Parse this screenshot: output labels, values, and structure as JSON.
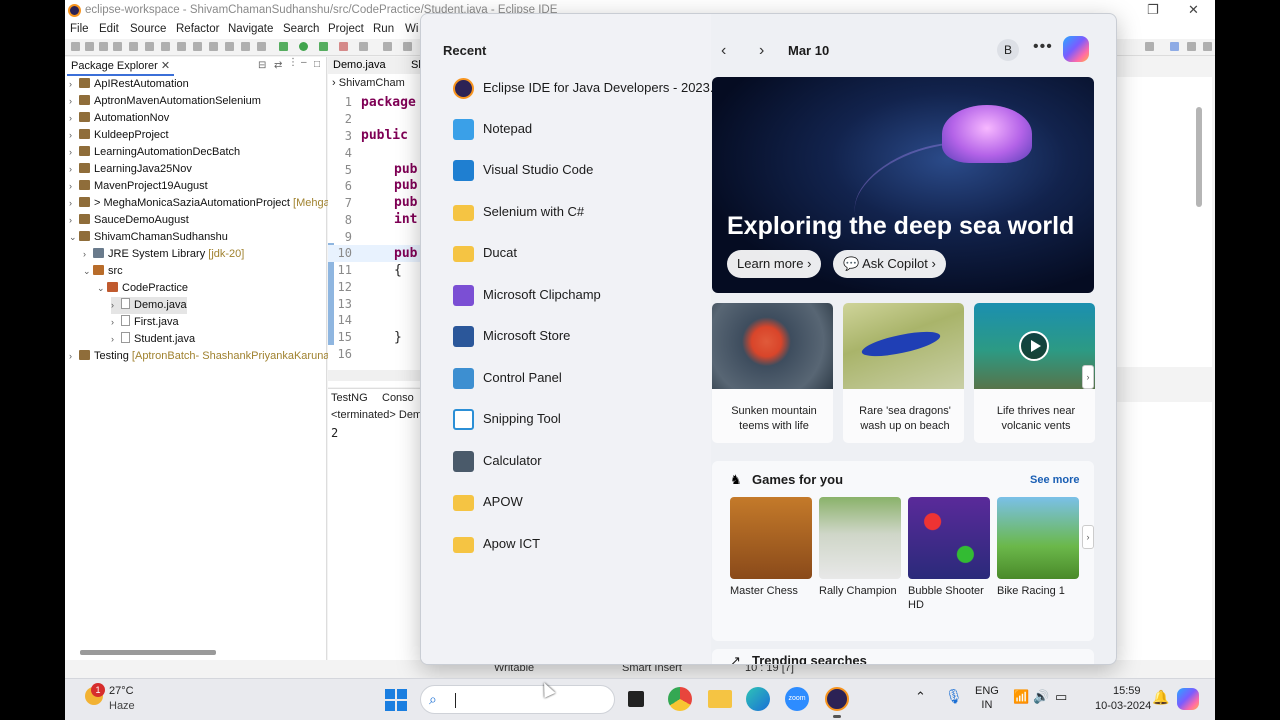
{
  "eclipse": {
    "window_title": "eclipse-workspace - ShivamChamanSudhanshu/src/CodePractice/Student.java - Eclipse IDE",
    "menu": [
      "File",
      "Edit",
      "Source",
      "Refactor",
      "Navigate",
      "Search",
      "Project",
      "Run",
      "Wi"
    ],
    "package_explorer": {
      "tab_label": "Package Explorer",
      "tab_close": "✕",
      "items": [
        {
          "label": "ApIRestAutomation",
          "suffix": ""
        },
        {
          "label": "AptronMavenAutomationSelenium",
          "suffix": ""
        },
        {
          "label": "AutomationNov",
          "suffix": ""
        },
        {
          "label": "KuldeepProject",
          "suffix": ""
        },
        {
          "label": "LearningAutomationDecBatch",
          "suffix": ""
        },
        {
          "label": "LearningJava25Nov",
          "suffix": ""
        },
        {
          "label": "MavenProject19August",
          "suffix": ""
        },
        {
          "label": "> MeghaMonicaSaziaAutomationProject",
          "suffix": "[Mehgal"
        },
        {
          "label": "SauceDemoAugust",
          "suffix": ""
        },
        {
          "label": "ShivamChamanSudhanshu",
          "suffix": ""
        },
        {
          "label": "JRE System Library",
          "suffix": "[jdk-20]"
        },
        {
          "label": "src",
          "suffix": ""
        },
        {
          "label": "CodePractice",
          "suffix": ""
        },
        {
          "label": "Demo.java",
          "suffix": ""
        },
        {
          "label": "First.java",
          "suffix": ""
        },
        {
          "label": "Student.java",
          "suffix": ""
        },
        {
          "label": "Testing",
          "suffix": "[AptronBatch- ShashankPriyankaKaruna m"
        }
      ]
    },
    "editor": {
      "tab1": "Demo.java",
      "tab2": "ShivamCham",
      "line_numbers": [
        "1",
        "2",
        "3",
        "4",
        "5",
        "6",
        "7",
        "8",
        "9",
        "10",
        "11",
        "12",
        "13",
        "14",
        "15",
        "16"
      ],
      "code": {
        "l1": "package",
        "l3": "public",
        "l5": "pub",
        "l6": "pub",
        "l7": "pub",
        "l8": "int",
        "l10": "pub",
        "l11": "{",
        "l15": "}"
      }
    },
    "console": {
      "tab1": "TestNG",
      "tab2": "Conso",
      "terminated": "<terminated> Dem",
      "output": "2"
    },
    "status": {
      "writable": "Writable",
      "insert": "Smart Insert",
      "position": "10 : 19 [7]"
    }
  },
  "start": {
    "recent_title": "Recent",
    "date": "Mar 10",
    "user_initial": "B",
    "more": "•••",
    "apps": [
      {
        "label": "Eclipse IDE for Java Developers - 2023...",
        "icon": "eclipse-icon",
        "color": "#2c2255"
      },
      {
        "label": "Notepad",
        "icon": "notepad-icon",
        "color": "#3aa0e8"
      },
      {
        "label": "Visual Studio Code",
        "icon": "vscode-icon",
        "color": "#1f7fd1"
      },
      {
        "label": "Selenium with C#",
        "icon": "folder-icon",
        "color": "#f5c443"
      },
      {
        "label": "Ducat",
        "icon": "folder-icon",
        "color": "#f5c443"
      },
      {
        "label": "Microsoft Clipchamp",
        "icon": "clipchamp-icon",
        "color": "#7b4fd4"
      },
      {
        "label": "Microsoft Store",
        "icon": "store-icon",
        "color": "#2b579a"
      },
      {
        "label": "Control Panel",
        "icon": "control-panel-icon",
        "color": "#3d8fd1"
      },
      {
        "label": "Snipping Tool",
        "icon": "snipping-tool-icon",
        "color": "#2b8fd6"
      },
      {
        "label": "Calculator",
        "icon": "calculator-icon",
        "color": "#4a5a6a"
      },
      {
        "label": "APOW",
        "icon": "folder-icon",
        "color": "#f5c443"
      },
      {
        "label": "Apow ICT",
        "icon": "folder-icon",
        "color": "#f5c443"
      }
    ],
    "hero": {
      "headline": "Exploring the deep sea world",
      "learn_more": "Learn more",
      "ask_copilot": "Ask Copilot"
    },
    "news": [
      {
        "caption": "Sunken mountain teems with life"
      },
      {
        "caption": "Rare 'sea dragons' wash up on beach"
      },
      {
        "caption": "Life thrives near volcanic vents"
      }
    ],
    "games": {
      "title": "Games for you",
      "see_more": "See more",
      "items": [
        {
          "label": "Master Chess"
        },
        {
          "label": "Rally Champion"
        },
        {
          "label": "Bubble Shooter HD"
        },
        {
          "label": "Bike Racing 1"
        }
      ]
    },
    "trending": "Trending searches"
  },
  "taskbar": {
    "weather_temp": "27°C",
    "weather_desc": "Haze",
    "weather_badge": "1",
    "lang1": "ENG",
    "lang2": "IN",
    "time": "15:59",
    "date": "10-03-2024"
  }
}
